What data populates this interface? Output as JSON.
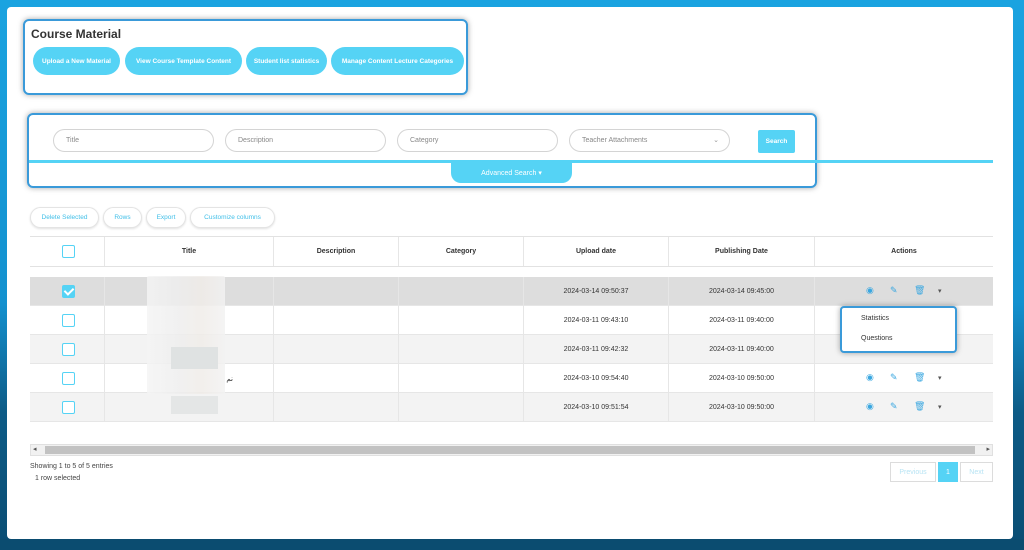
{
  "header": {
    "title": "Course Material",
    "buttons": [
      {
        "label": "Upload a New Material"
      },
      {
        "label": "View Course Template Content"
      },
      {
        "label": "Student list statistics"
      },
      {
        "label": "Manage Content Lecture Categories"
      }
    ]
  },
  "search": {
    "title_placeholder": "Title",
    "description_placeholder": "Description",
    "category_placeholder": "Category",
    "teacher_select": "Teacher Attachments",
    "search_label": "Search",
    "advanced_label": "Advanced Search ▾"
  },
  "toolbar": {
    "delete_label": "Delete Selected",
    "rows_label": "Rows",
    "export_label": "Export",
    "customize_label": "Customize columns"
  },
  "table": {
    "columns": [
      "",
      "Title",
      "Description",
      "Category",
      "Upload date",
      "Publishing Date",
      "Actions"
    ],
    "rows": [
      {
        "checked": true,
        "title": "",
        "upload": "2024-03-14 09:50:37",
        "publish": "2024-03-14 09:45:00"
      },
      {
        "checked": false,
        "title": "",
        "upload": "2024-03-11 09:43:10",
        "publish": "2024-03-11 09:40:00"
      },
      {
        "checked": false,
        "title": "",
        "upload": "2024-03-11 09:42:32",
        "publish": "2024-03-11 09:40:00"
      },
      {
        "checked": false,
        "title": "نم",
        "upload": "2024-03-10 09:54:40",
        "publish": "2024-03-10 09:50:00"
      },
      {
        "checked": false,
        "title": "",
        "upload": "2024-03-10 09:51:54",
        "publish": "2024-03-10 09:50:00"
      }
    ]
  },
  "dropdown": {
    "items": [
      "Statistics",
      "Questions"
    ]
  },
  "footer": {
    "showing": "Showing 1 to 5 of 5 entries",
    "selected": "1 row selected",
    "prev_label": "Previous",
    "page_label": "1",
    "next_label": "Next"
  },
  "colors": {
    "accent": "#55d3f5",
    "frame": "#3a9ad9",
    "background": "#1aa3e0"
  }
}
